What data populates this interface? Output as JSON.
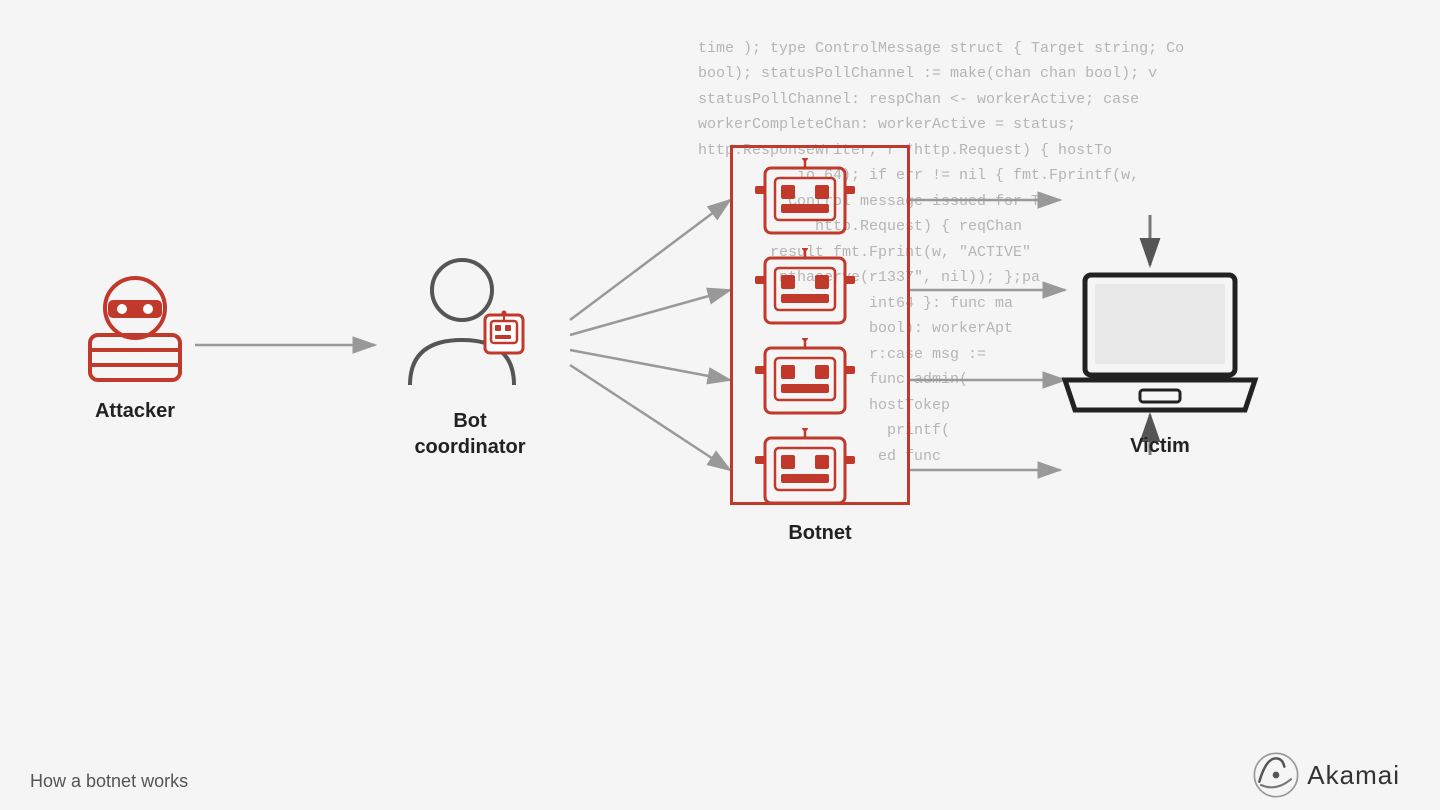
{
  "code_lines": [
    "time ); type ControlMessage struct { Target string; Co",
    "bool); statusPollChannel := make(chan chan bool); v",
    "statusPollChannel: respChan <- workerActive; case",
    "workerCompleteChan: workerActive = status;",
    "http.ResponseWriter, r *http.Request) { hostTo",
    "io 64); if err != nil { fmt.Fprintf(w,",
    "Control message issued for Ta",
    "http.Request) { reqChan",
    "result fmt.Fprint(w, \"ACTIVE\"",
    "nthaserve(r1337\", nil)); };pa",
    "int64 }: func ma",
    "bool): workerApt",
    "r:case msg :=",
    "func admin(",
    "hostTokep",
    "printf(",
    "ed func"
  ],
  "caption": "How a botnet works",
  "nodes": {
    "attacker": {
      "label": "Attacker"
    },
    "bot_coordinator": {
      "label": "Bot\ncoordinator"
    },
    "botnet": {
      "label": "Botnet"
    },
    "victim": {
      "label": "Victim"
    }
  },
  "akamai": {
    "text": "Akamai"
  }
}
